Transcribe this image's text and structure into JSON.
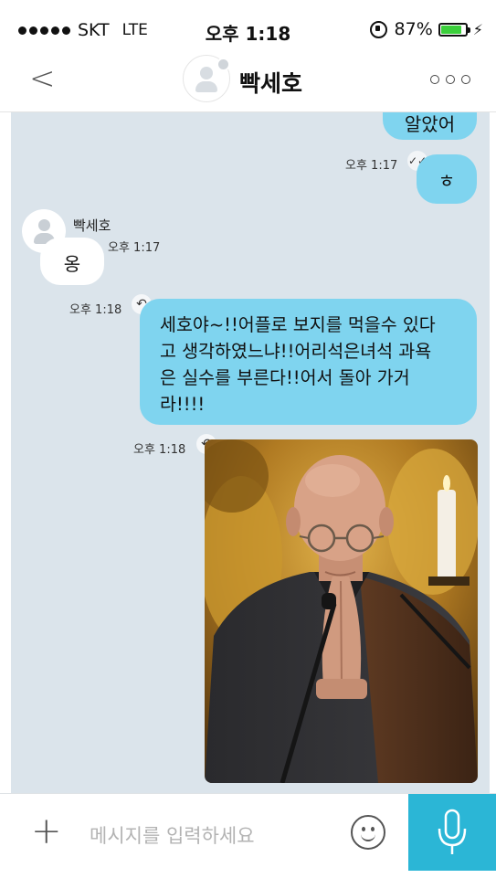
{
  "status_bar": {
    "carrier": "SKT",
    "network": "LTE",
    "time": "오후 1:18",
    "battery": "87%",
    "battery_fraction": 0.87
  },
  "header": {
    "back_icon": "chevron-left-icon",
    "contact_name": "빡세호",
    "more_icon": "more-dots-icon"
  },
  "chat": {
    "messages": [
      {
        "id": "m0",
        "direction": "out",
        "text": "알았어",
        "time": ""
      },
      {
        "id": "m1",
        "direction": "out",
        "text": "ㅎ",
        "time": "오후 1:17",
        "status_icon": "read-check-icon"
      },
      {
        "id": "m2",
        "direction": "in",
        "sender": "빡세호",
        "text": "옹",
        "time": "오후 1:17"
      },
      {
        "id": "m3",
        "direction": "out",
        "lines": [
          "세호야~!!어플로 보지를 먹을수 있다",
          "고 생각하였느냐!!어리석은녀석 과욕",
          "은 실수를 부른다!!어서 돌아 가거",
          "라!!!!"
        ],
        "time": "오후 1:18",
        "status_icon": "reply-icon"
      },
      {
        "id": "m4",
        "direction": "out",
        "type": "image",
        "image_desc": "photo-message",
        "time": "오후 1:18",
        "status_icon": "reply-icon"
      }
    ]
  },
  "input": {
    "placeholder": "메시지를 입력하세요",
    "plus_icon": "plus-icon",
    "emoji_icon": "emoji-icon",
    "mic_icon": "microphone-icon"
  },
  "colors": {
    "out_bubble": "#7fd4ef",
    "in_bubble": "#ffffff",
    "chat_bg": "#dbe4eb",
    "mic_bg": "#2bb6d6"
  }
}
